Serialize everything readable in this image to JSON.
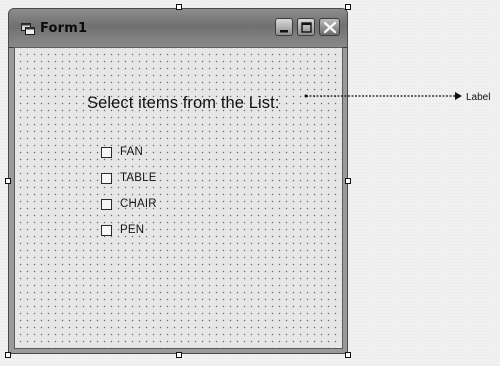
{
  "window": {
    "title": "Form1",
    "buttons": {
      "minimize": "minimize-icon",
      "maximize": "maximize-icon",
      "close": "close-icon"
    }
  },
  "form": {
    "label_text": "Select items from the List:",
    "checkboxes": [
      {
        "label": "FAN",
        "checked": false
      },
      {
        "label": "TABLE",
        "checked": false
      },
      {
        "label": "CHAIR",
        "checked": false
      },
      {
        "label": "PEN",
        "checked": false
      }
    ]
  },
  "annotation": {
    "text": "Label"
  },
  "icons": {
    "title": "form-window-icon",
    "arrow": "arrow-right-icon"
  },
  "colors": {
    "title_bar": "#777777",
    "client_area": "#e6e6e6",
    "window_border": "#4a4a4a"
  }
}
